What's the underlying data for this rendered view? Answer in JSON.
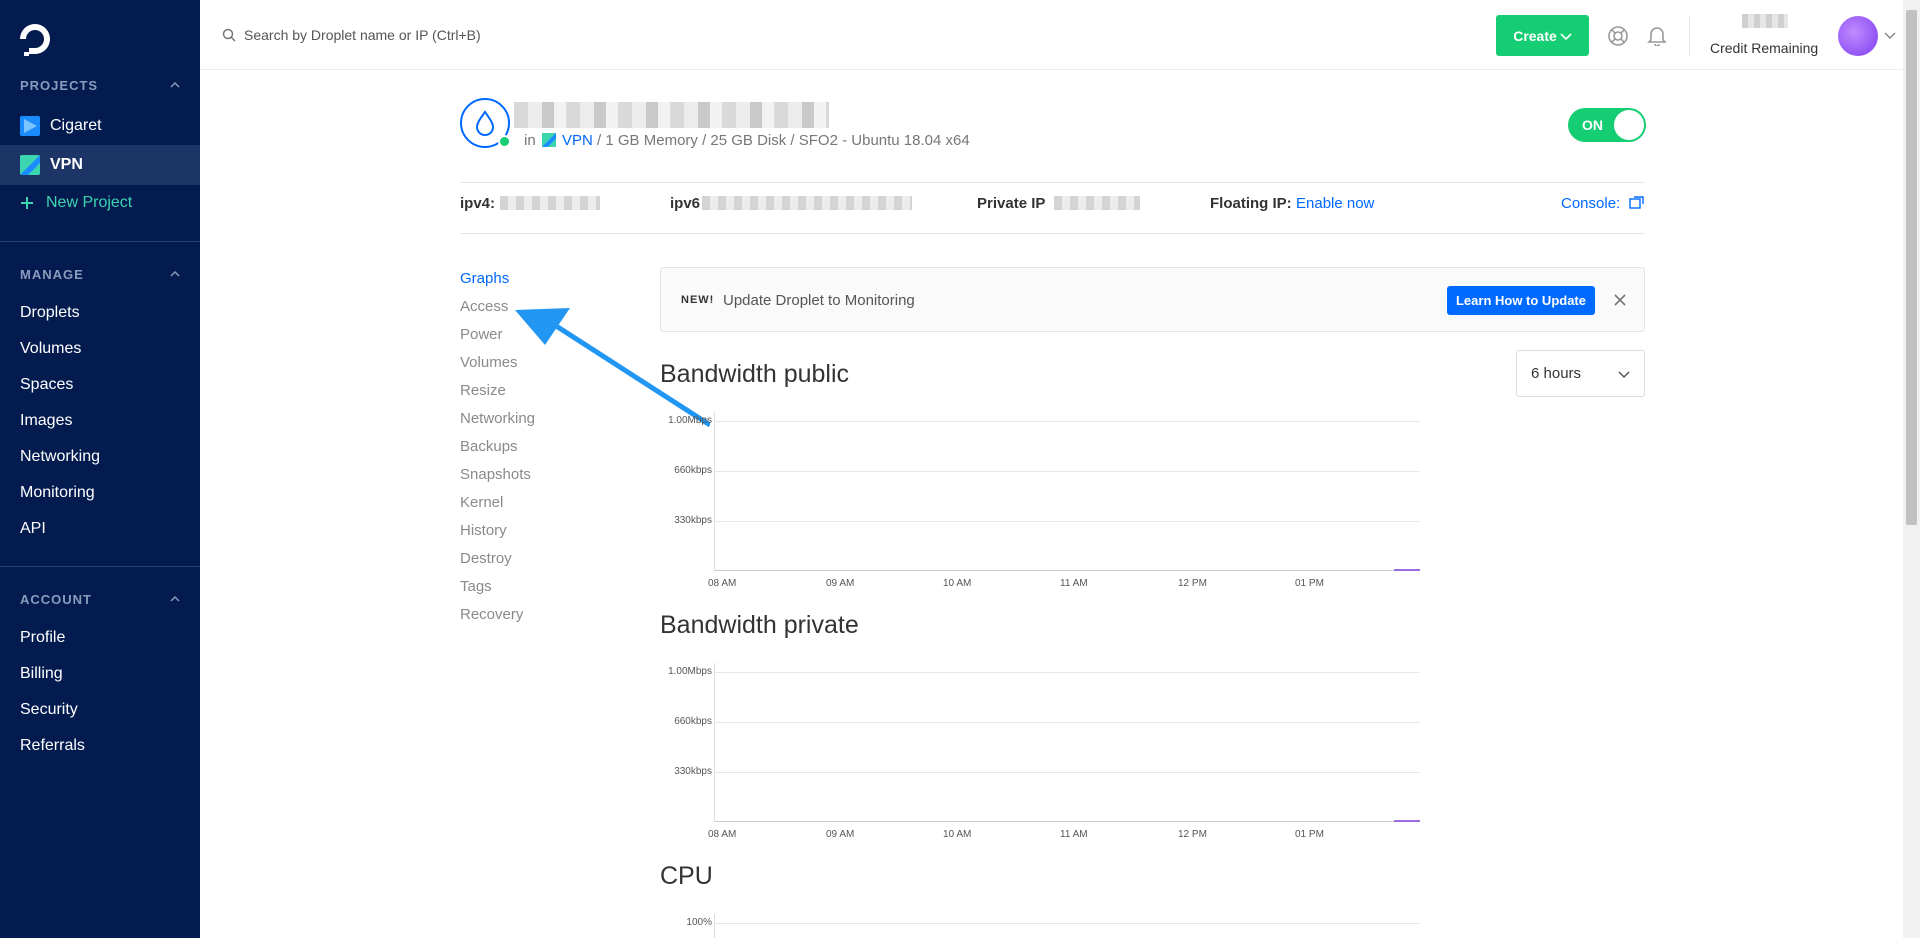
{
  "sidebar": {
    "projects_title": "PROJECTS",
    "projects": [
      {
        "label": "Cigaret",
        "active": false,
        "color": "#1a8cff"
      },
      {
        "label": "VPN",
        "active": true,
        "color": "#3cd5af"
      }
    ],
    "new_project": "New Project",
    "manage_title": "MANAGE",
    "manage_items": [
      "Droplets",
      "Volumes",
      "Spaces",
      "Images",
      "Networking",
      "Monitoring",
      "API"
    ],
    "account_title": "ACCOUNT",
    "account_items": [
      "Profile",
      "Billing",
      "Security",
      "Referrals"
    ]
  },
  "header": {
    "search_placeholder": "Search by Droplet name or IP (Ctrl+B)",
    "create_label": "Create",
    "credit_label": "Credit Remaining"
  },
  "droplet": {
    "meta_prefix": "in",
    "project": "VPN",
    "meta_suffix": "/ 1 GB Memory / 25 GB Disk / SFO2 - Ubuntu 18.04 x64",
    "power_label": "ON",
    "ipv4_label": "ipv4:",
    "ipv6_label": "ipv6",
    "private_ip_label": "Private IP",
    "floating_ip_label": "Floating IP:",
    "floating_ip_link": "Enable now",
    "console_label": "Console:"
  },
  "subnav": [
    "Graphs",
    "Access",
    "Power",
    "Volumes",
    "Resize",
    "Networking",
    "Backups",
    "Snapshots",
    "Kernel",
    "History",
    "Destroy",
    "Tags",
    "Recovery"
  ],
  "notice": {
    "badge": "NEW!",
    "text": "Update Droplet to Monitoring",
    "button": "Learn How to Update"
  },
  "time_range": "6 hours",
  "chart_data": [
    {
      "type": "line",
      "title": "Bandwidth public",
      "y_ticks": [
        "1.00Mbps",
        "660kbps",
        "330kbps"
      ],
      "categories": [
        "08 AM",
        "09 AM",
        "10 AM",
        "11 AM",
        "12 PM",
        "01 PM"
      ],
      "ylim": [
        0,
        1000
      ],
      "series": [
        {
          "values": [
            0,
            0,
            0,
            0,
            0,
            0
          ]
        }
      ]
    },
    {
      "type": "line",
      "title": "Bandwidth private",
      "y_ticks": [
        "1.00Mbps",
        "660kbps",
        "330kbps"
      ],
      "categories": [
        "08 AM",
        "09 AM",
        "10 AM",
        "11 AM",
        "12 PM",
        "01 PM"
      ],
      "ylim": [
        0,
        1000
      ],
      "series": [
        {
          "values": [
            0,
            0,
            0,
            0,
            0,
            0
          ]
        }
      ]
    },
    {
      "type": "line",
      "title": "CPU",
      "y_ticks": [
        "100%"
      ],
      "categories": [],
      "series": []
    }
  ]
}
